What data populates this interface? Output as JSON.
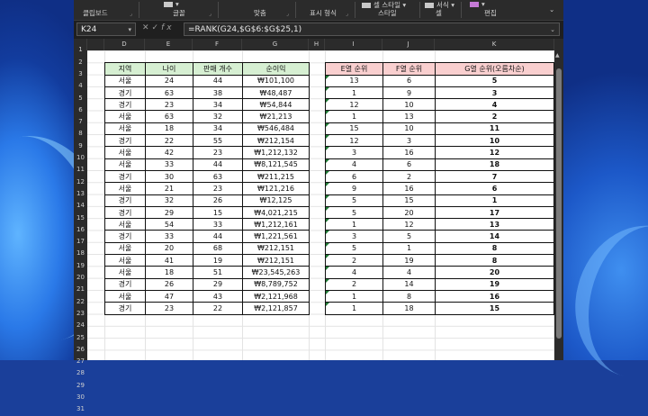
{
  "ribbon": {
    "groups": [
      {
        "label": "클립보드",
        "icon": "clipboard-icon"
      },
      {
        "label": "글꼴",
        "icon": "font-icon"
      },
      {
        "label": "맞춤",
        "icon": "align-icon"
      },
      {
        "label": "표시 형식",
        "icon": "number-format-icon"
      },
      {
        "label": "스타일",
        "icon": "styles-icon",
        "partial_top": "셀 스타일"
      },
      {
        "label": "셀",
        "icon": "cells-icon",
        "partial_top": "서식"
      },
      {
        "label": "편집",
        "icon": "editing-icon"
      }
    ]
  },
  "formula_bar": {
    "name_box": "K24",
    "formula": "=RANK(G24,$G$6:$G$25,1)",
    "cancel": "✕",
    "enter": "✓",
    "fx": "fx"
  },
  "columns": [
    "D",
    "E",
    "F",
    "G",
    "H",
    "I",
    "J",
    "K"
  ],
  "rows": [
    "1",
    "2",
    "3",
    "4",
    "5",
    "6",
    "7",
    "8",
    "9",
    "10",
    "11",
    "12",
    "13",
    "14",
    "15",
    "16",
    "17",
    "18",
    "19",
    "20",
    "21",
    "22",
    "23",
    "24",
    "25",
    "26",
    "27",
    "28",
    "29",
    "30",
    "31"
  ],
  "table1": {
    "headers": [
      "지역",
      "나이",
      "판매 개수",
      "순이익"
    ],
    "rows": [
      [
        "서울",
        "24",
        "44",
        "₩101,100"
      ],
      [
        "경기",
        "63",
        "38",
        "₩48,487"
      ],
      [
        "경기",
        "23",
        "34",
        "₩54,844"
      ],
      [
        "서울",
        "63",
        "32",
        "₩21,213"
      ],
      [
        "서울",
        "18",
        "34",
        "₩546,484"
      ],
      [
        "경기",
        "22",
        "55",
        "₩212,154"
      ],
      [
        "서울",
        "42",
        "23",
        "₩1,212,132"
      ],
      [
        "서울",
        "33",
        "44",
        "₩8,121,545"
      ],
      [
        "경기",
        "30",
        "63",
        "₩211,215"
      ],
      [
        "서울",
        "21",
        "23",
        "₩121,216"
      ],
      [
        "경기",
        "32",
        "26",
        "₩12,125"
      ],
      [
        "경기",
        "29",
        "15",
        "₩4,021,215"
      ],
      [
        "서울",
        "54",
        "33",
        "₩1,212,161"
      ],
      [
        "경기",
        "33",
        "44",
        "₩1,221,561"
      ],
      [
        "서울",
        "20",
        "68",
        "₩212,151"
      ],
      [
        "서울",
        "41",
        "19",
        "₩212,151"
      ],
      [
        "서울",
        "18",
        "51",
        "₩23,545,263"
      ],
      [
        "경기",
        "26",
        "29",
        "₩8,789,752"
      ],
      [
        "서울",
        "47",
        "43",
        "₩2,121,968"
      ],
      [
        "경기",
        "23",
        "22",
        "₩2,121,857"
      ]
    ]
  },
  "table2": {
    "headers": [
      "E열 순위",
      "F열 순위",
      "G열 순위(오름차순)"
    ],
    "rows": [
      [
        "13",
        "6",
        "5"
      ],
      [
        "1",
        "9",
        "3"
      ],
      [
        "12",
        "10",
        "4"
      ],
      [
        "1",
        "13",
        "2"
      ],
      [
        "15",
        "10",
        "11"
      ],
      [
        "12",
        "3",
        "10"
      ],
      [
        "3",
        "16",
        "12"
      ],
      [
        "4",
        "6",
        "18"
      ],
      [
        "6",
        "2",
        "7"
      ],
      [
        "9",
        "16",
        "6"
      ],
      [
        "5",
        "15",
        "1"
      ],
      [
        "5",
        "20",
        "17"
      ],
      [
        "1",
        "12",
        "13"
      ],
      [
        "3",
        "5",
        "14"
      ],
      [
        "5",
        "1",
        "8"
      ],
      [
        "2",
        "19",
        "8"
      ],
      [
        "4",
        "4",
        "20"
      ],
      [
        "2",
        "14",
        "19"
      ],
      [
        "1",
        "8",
        "16"
      ],
      [
        "1",
        "18",
        "15"
      ]
    ]
  }
}
